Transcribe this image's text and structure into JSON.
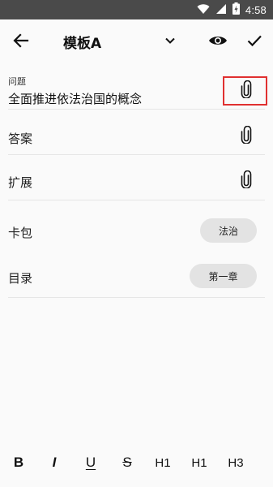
{
  "status_bar": {
    "time": "4:58",
    "icons": [
      "wifi-icon",
      "signal-icon",
      "battery-charging-icon"
    ]
  },
  "toolbar": {
    "title": "模板A",
    "back_icon": "arrow-left-icon",
    "dropdown_icon": "chevron-down-icon",
    "preview_icon": "eye-icon",
    "confirm_icon": "check-icon"
  },
  "fields": {
    "question": {
      "label": "问题",
      "value": "全面推进依法治国的概念",
      "attach_icon": "paperclip-icon"
    },
    "answer": {
      "label": "答案",
      "attach_icon": "paperclip-icon"
    },
    "extension": {
      "label": "扩展",
      "attach_icon": "paperclip-icon"
    },
    "deck": {
      "label": "卡包",
      "value": "法治"
    },
    "catalog": {
      "label": "目录",
      "value": "第一章"
    }
  },
  "format_bar": {
    "bold": "B",
    "italic": "I",
    "underline": "U",
    "strikethrough": "S",
    "h1": "H1",
    "h1_alt": "H1",
    "h3": "H3"
  },
  "colors": {
    "status_bar_bg": "#4a4a4a",
    "background": "#fafafa",
    "chip_bg": "#e3e3e3",
    "highlight_border": "#e03030"
  }
}
